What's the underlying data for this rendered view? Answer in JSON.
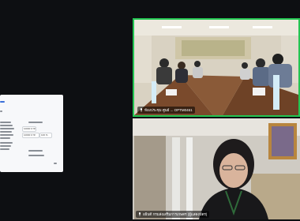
{
  "shared_document": {
    "field_1": "10000 บาท",
    "field_2": "10000 บาท",
    "percent": "100 %"
  },
  "participants": [
    {
      "name": "ห้องประชุม ศูนย์ ... OPTM0461",
      "active_speaker": true
    },
    {
      "name": "อธิบดี กรมส่งเสริมการเกษตร (ผู้แสดงบัตร)",
      "active_speaker": false
    }
  ],
  "colors": {
    "active_speaker_border": "#23c552",
    "background": "#0d0f12"
  }
}
